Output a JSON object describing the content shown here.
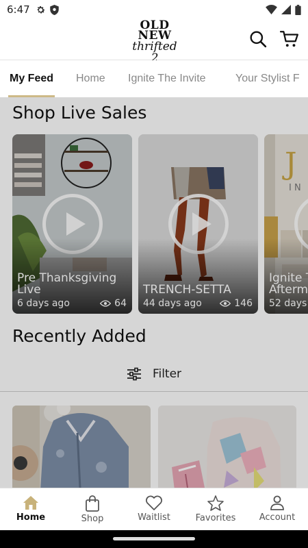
{
  "status_bar": {
    "time": "6:47"
  },
  "header": {
    "logo_line1": "OLD",
    "logo_line2": "NEW",
    "logo_line3": "thrifted 2"
  },
  "tabs": [
    {
      "label": "My Feed",
      "active": true
    },
    {
      "label": "Home",
      "active": false
    },
    {
      "label": "Ignite The Invite",
      "active": false
    },
    {
      "label": "Your Stylist F",
      "active": false
    }
  ],
  "feed": {
    "live_sales_title": "Shop Live Sales",
    "live_sales": [
      {
        "title": "Pre Thanksgiving Live",
        "age": "6 days ago",
        "views": "64"
      },
      {
        "title": "TRENCH-SETTA",
        "age": "44 days ago",
        "views": "146"
      },
      {
        "title": "Ignite T Afterm",
        "age": "52 days",
        "views": ""
      }
    ],
    "recently_added_title": "Recently Added",
    "filter_label": "Filter"
  },
  "bottom_nav": [
    {
      "label": "Home",
      "icon": "home-icon",
      "active": true
    },
    {
      "label": "Shop",
      "icon": "shopping-bag-icon",
      "active": false
    },
    {
      "label": "Waitlist",
      "icon": "heart-icon",
      "active": false
    },
    {
      "label": "Favorites",
      "icon": "star-icon",
      "active": false
    },
    {
      "label": "Account",
      "icon": "person-icon",
      "active": false
    }
  ],
  "colors": {
    "accent": "#cdb987",
    "home_icon": "#c8b27a"
  }
}
